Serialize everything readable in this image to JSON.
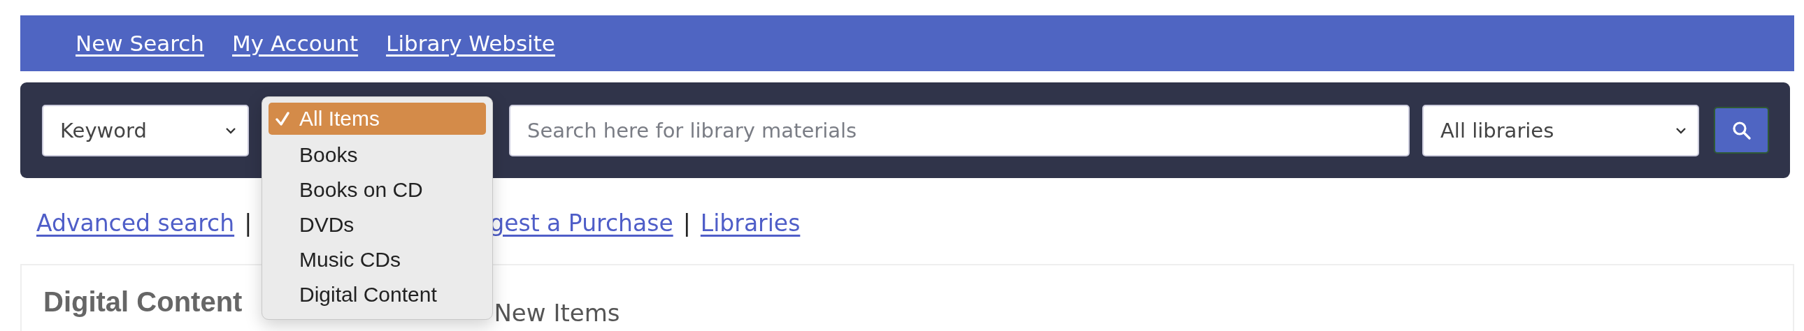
{
  "top_nav": {
    "links": [
      "New Search",
      "My Account",
      "Library Website"
    ]
  },
  "search_bar": {
    "search_type": "Keyword",
    "query": {
      "placeholder": "Search here for library materials"
    },
    "library": "All libraries"
  },
  "type_menu": {
    "items": [
      {
        "label": "All Items",
        "selected": true
      },
      {
        "label": "Books",
        "selected": false
      },
      {
        "label": "Books on CD",
        "selected": false
      },
      {
        "label": "DVDs",
        "selected": false
      },
      {
        "label": "Music CDs",
        "selected": false
      },
      {
        "label": "Digital Content",
        "selected": false
      }
    ]
  },
  "links": [
    {
      "label": "Advanced search",
      "kind": "link"
    },
    {
      "label": "|",
      "kind": "separator"
    },
    {
      "label": "gest a Purchase",
      "kind": "partial_link"
    },
    {
      "label": "|",
      "kind": "separator"
    },
    {
      "label": "Libraries",
      "kind": "link"
    }
  ],
  "card": {
    "title": "Digital Content",
    "tab": "New Items"
  }
}
